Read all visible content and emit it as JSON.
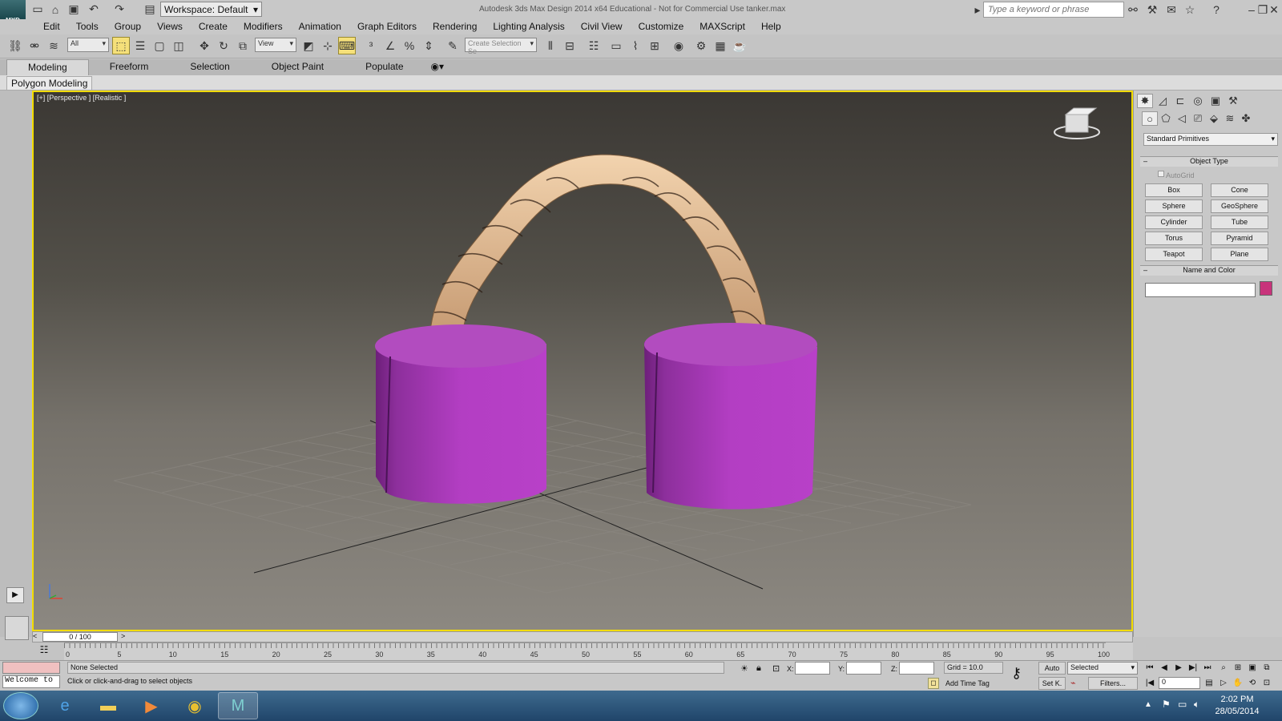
{
  "window": {
    "title": "Autodesk 3ds Max Design 2014 x64   Educational - Not for Commercial Use    tanker.max",
    "logo_text": "MXD",
    "workspace": "Workspace: Default",
    "search_placeholder": "Type a keyword or phrase"
  },
  "menu": [
    "Edit",
    "Tools",
    "Group",
    "Views",
    "Create",
    "Modifiers",
    "Animation",
    "Graph Editors",
    "Rendering",
    "Lighting Analysis",
    "Civil View",
    "Customize",
    "MAXScript",
    "Help"
  ],
  "toolbar": {
    "filter_select": "All",
    "ref_coord": "View",
    "selection_set_placeholder": "Create Selection Se"
  },
  "ribbon": {
    "tabs": [
      "Modeling",
      "Freeform",
      "Selection",
      "Object Paint",
      "Populate"
    ],
    "active_tab": "Modeling",
    "panel_label": "Polygon Modeling"
  },
  "viewport": {
    "label": "[+] [Perspective ] [Realistic ]",
    "object_colors": {
      "cylinders": "#b23bc0",
      "hose": "#e6c49d",
      "selection_border": "#f2dc00"
    }
  },
  "command_panel": {
    "category": "Standard Primitives",
    "object_type_title": "Object Type",
    "autogrid": "AutoGrid",
    "buttons": [
      "Box",
      "Cone",
      "Sphere",
      "GeoSphere",
      "Cylinder",
      "Tube",
      "Torus",
      "Pyramid",
      "Teapot",
      "Plane"
    ],
    "name_color_title": "Name and Color",
    "name_value": "",
    "swatch_color": "#c8337b"
  },
  "timeline": {
    "frame": "0 / 100",
    "ticks": [
      "0",
      "5",
      "10",
      "15",
      "20",
      "25",
      "30",
      "35",
      "40",
      "45",
      "50",
      "55",
      "60",
      "65",
      "70",
      "75",
      "80",
      "85",
      "90",
      "95",
      "100"
    ]
  },
  "status": {
    "selection": "None Selected",
    "prompt": "Click or click-and-drag to select objects",
    "welcome": "Welcome to",
    "x_label": "X:",
    "y_label": "Y:",
    "z_label": "Z:",
    "grid": "Grid = 10.0",
    "add_time_tag": "Add Time Tag",
    "auto": "Auto",
    "set_key": "Set K.",
    "key_filter": "Selected",
    "filters": "Filters...",
    "current_frame": "0"
  },
  "taskbar": {
    "time": "2:02 PM",
    "date": "28/05/2014",
    "apps": [
      "internet-explorer",
      "file-explorer",
      "media-player",
      "chrome",
      "3ds-max"
    ]
  }
}
